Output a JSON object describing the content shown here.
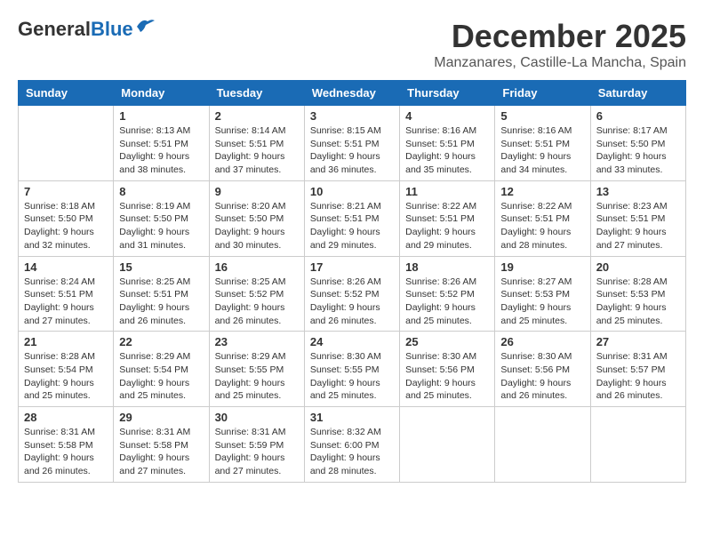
{
  "header": {
    "logo_general": "General",
    "logo_blue": "Blue",
    "month": "December 2025",
    "location": "Manzanares, Castille-La Mancha, Spain"
  },
  "days_of_week": [
    "Sunday",
    "Monday",
    "Tuesday",
    "Wednesday",
    "Thursday",
    "Friday",
    "Saturday"
  ],
  "weeks": [
    [
      {
        "day": "",
        "info": ""
      },
      {
        "day": "1",
        "info": "Sunrise: 8:13 AM\nSunset: 5:51 PM\nDaylight: 9 hours\nand 38 minutes."
      },
      {
        "day": "2",
        "info": "Sunrise: 8:14 AM\nSunset: 5:51 PM\nDaylight: 9 hours\nand 37 minutes."
      },
      {
        "day": "3",
        "info": "Sunrise: 8:15 AM\nSunset: 5:51 PM\nDaylight: 9 hours\nand 36 minutes."
      },
      {
        "day": "4",
        "info": "Sunrise: 8:16 AM\nSunset: 5:51 PM\nDaylight: 9 hours\nand 35 minutes."
      },
      {
        "day": "5",
        "info": "Sunrise: 8:16 AM\nSunset: 5:51 PM\nDaylight: 9 hours\nand 34 minutes."
      },
      {
        "day": "6",
        "info": "Sunrise: 8:17 AM\nSunset: 5:50 PM\nDaylight: 9 hours\nand 33 minutes."
      }
    ],
    [
      {
        "day": "7",
        "info": "Sunrise: 8:18 AM\nSunset: 5:50 PM\nDaylight: 9 hours\nand 32 minutes."
      },
      {
        "day": "8",
        "info": "Sunrise: 8:19 AM\nSunset: 5:50 PM\nDaylight: 9 hours\nand 31 minutes."
      },
      {
        "day": "9",
        "info": "Sunrise: 8:20 AM\nSunset: 5:50 PM\nDaylight: 9 hours\nand 30 minutes."
      },
      {
        "day": "10",
        "info": "Sunrise: 8:21 AM\nSunset: 5:51 PM\nDaylight: 9 hours\nand 29 minutes."
      },
      {
        "day": "11",
        "info": "Sunrise: 8:22 AM\nSunset: 5:51 PM\nDaylight: 9 hours\nand 29 minutes."
      },
      {
        "day": "12",
        "info": "Sunrise: 8:22 AM\nSunset: 5:51 PM\nDaylight: 9 hours\nand 28 minutes."
      },
      {
        "day": "13",
        "info": "Sunrise: 8:23 AM\nSunset: 5:51 PM\nDaylight: 9 hours\nand 27 minutes."
      }
    ],
    [
      {
        "day": "14",
        "info": "Sunrise: 8:24 AM\nSunset: 5:51 PM\nDaylight: 9 hours\nand 27 minutes."
      },
      {
        "day": "15",
        "info": "Sunrise: 8:25 AM\nSunset: 5:51 PM\nDaylight: 9 hours\nand 26 minutes."
      },
      {
        "day": "16",
        "info": "Sunrise: 8:25 AM\nSunset: 5:52 PM\nDaylight: 9 hours\nand 26 minutes."
      },
      {
        "day": "17",
        "info": "Sunrise: 8:26 AM\nSunset: 5:52 PM\nDaylight: 9 hours\nand 26 minutes."
      },
      {
        "day": "18",
        "info": "Sunrise: 8:26 AM\nSunset: 5:52 PM\nDaylight: 9 hours\nand 25 minutes."
      },
      {
        "day": "19",
        "info": "Sunrise: 8:27 AM\nSunset: 5:53 PM\nDaylight: 9 hours\nand 25 minutes."
      },
      {
        "day": "20",
        "info": "Sunrise: 8:28 AM\nSunset: 5:53 PM\nDaylight: 9 hours\nand 25 minutes."
      }
    ],
    [
      {
        "day": "21",
        "info": "Sunrise: 8:28 AM\nSunset: 5:54 PM\nDaylight: 9 hours\nand 25 minutes."
      },
      {
        "day": "22",
        "info": "Sunrise: 8:29 AM\nSunset: 5:54 PM\nDaylight: 9 hours\nand 25 minutes."
      },
      {
        "day": "23",
        "info": "Sunrise: 8:29 AM\nSunset: 5:55 PM\nDaylight: 9 hours\nand 25 minutes."
      },
      {
        "day": "24",
        "info": "Sunrise: 8:30 AM\nSunset: 5:55 PM\nDaylight: 9 hours\nand 25 minutes."
      },
      {
        "day": "25",
        "info": "Sunrise: 8:30 AM\nSunset: 5:56 PM\nDaylight: 9 hours\nand 25 minutes."
      },
      {
        "day": "26",
        "info": "Sunrise: 8:30 AM\nSunset: 5:56 PM\nDaylight: 9 hours\nand 26 minutes."
      },
      {
        "day": "27",
        "info": "Sunrise: 8:31 AM\nSunset: 5:57 PM\nDaylight: 9 hours\nand 26 minutes."
      }
    ],
    [
      {
        "day": "28",
        "info": "Sunrise: 8:31 AM\nSunset: 5:58 PM\nDaylight: 9 hours\nand 26 minutes."
      },
      {
        "day": "29",
        "info": "Sunrise: 8:31 AM\nSunset: 5:58 PM\nDaylight: 9 hours\nand 27 minutes."
      },
      {
        "day": "30",
        "info": "Sunrise: 8:31 AM\nSunset: 5:59 PM\nDaylight: 9 hours\nand 27 minutes."
      },
      {
        "day": "31",
        "info": "Sunrise: 8:32 AM\nSunset: 6:00 PM\nDaylight: 9 hours\nand 28 minutes."
      },
      {
        "day": "",
        "info": ""
      },
      {
        "day": "",
        "info": ""
      },
      {
        "day": "",
        "info": ""
      }
    ]
  ]
}
